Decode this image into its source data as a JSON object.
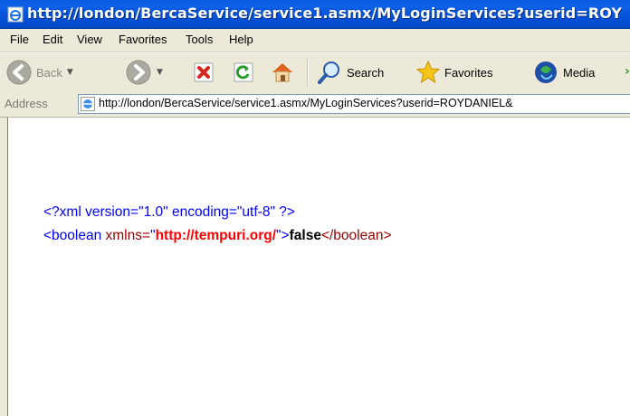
{
  "window": {
    "title": "http://london/BercaService/service1.asmx/MyLoginServices?userid=ROY"
  },
  "menu": {
    "items": [
      "File",
      "Edit",
      "View",
      "Favorites",
      "Tools",
      "Help"
    ]
  },
  "toolbar": {
    "back_label": "Back",
    "search_label": "Search",
    "favorites_label": "Favorites",
    "media_label": "Media"
  },
  "address": {
    "label": "Address",
    "url": "http://london/BercaService/service1.asmx/MyLoginServices?userid=ROYDANIEL&"
  },
  "document": {
    "decl": "<?xml version=\"1.0\" encoding=\"utf-8\" ?>",
    "open_tag": "<boolean",
    "attr_name": " xmlns=",
    "quote_open": "\"",
    "attr_value": "http://tempuri.org/",
    "quote_close": "\"",
    "tag_end": ">",
    "value": "false",
    "close_tag": "</boolean>"
  },
  "colors": {
    "titlebar": "#0553dc",
    "chrome": "#ece9d8",
    "xml_markup": "#0000ff",
    "xml_tag": "#990000",
    "xml_attr_value": "#ff0000"
  }
}
